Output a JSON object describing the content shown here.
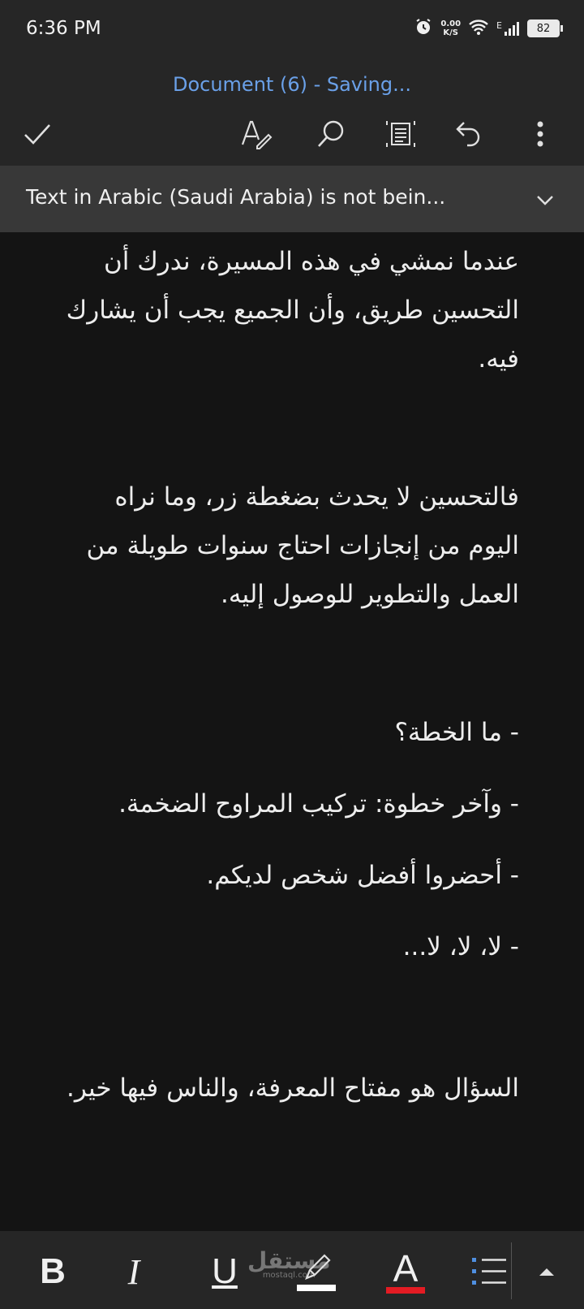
{
  "status": {
    "time": "6:36 PM",
    "net_speed_value": "0.00",
    "net_speed_unit": "K/S",
    "network_type": "E",
    "battery": "82"
  },
  "title": "Document (6) - Saving...",
  "toolbar_icons": [
    "check-icon",
    "pen-icon",
    "search-icon",
    "reading-view-icon",
    "undo-icon",
    "more-icon"
  ],
  "banner": {
    "text": "Text in Arabic (Saudi Arabia) is not bein..."
  },
  "document": {
    "paragraphs": [
      "عندما نمشي في هذه المسيرة، ندرك أن التحسين طريق، وأن الجميع يجب أن يشارك فيه.",
      "فالتحسين لا يحدث بضغطة زر، وما نراه اليوم من إنجازات احتاج سنوات طويلة من العمل والتطوير للوصول إليه.",
      "- ما الخطة؟",
      "- وآخر خطوة: تركيب المراوح الضخمة.",
      "- أحضروا أفضل شخص لديكم.",
      "- لا، لا، لا...",
      "السؤال هو مفتاح المعرفة، والناس فيها خير."
    ]
  },
  "formatbar": {
    "bold": "B",
    "italic": "I",
    "underline": "U",
    "font_color": "A",
    "highlight_color": "#ffffff",
    "font_color_swatch": "#e31b23",
    "watermark_text": "مستقل",
    "watermark_sub": "mostaql.com"
  },
  "colors": {
    "accent": "#6aa0e8",
    "background": "#141414",
    "bar": "#262626"
  }
}
